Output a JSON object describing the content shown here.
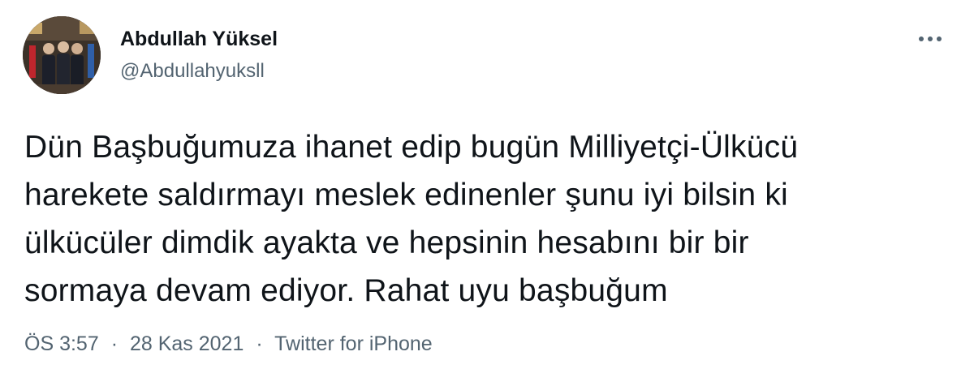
{
  "author": {
    "display_name": "Abdullah Yüksel",
    "handle": "@Abdullahyuksll"
  },
  "tweet": {
    "lines": [
      "Dün Başbuğumuza ihanet edip bugün Milliyetçi-Ülkücü",
      "harekete saldırmayı meslek edinenler şunu iyi bilsin ki",
      "ülkücüler dimdik ayakta ve hepsinin hesabını bir bir",
      "sormaya devam ediyor. Rahat uyu başbuğum"
    ]
  },
  "meta": {
    "time": "ÖS 3:57",
    "separator": "·",
    "date": "28 Kas 2021",
    "source": "Twitter for iPhone"
  },
  "icons": {
    "more": "more-horizontal-icon"
  },
  "colors": {
    "text": "#0f1419",
    "secondary": "#536471",
    "background": "#ffffff"
  }
}
